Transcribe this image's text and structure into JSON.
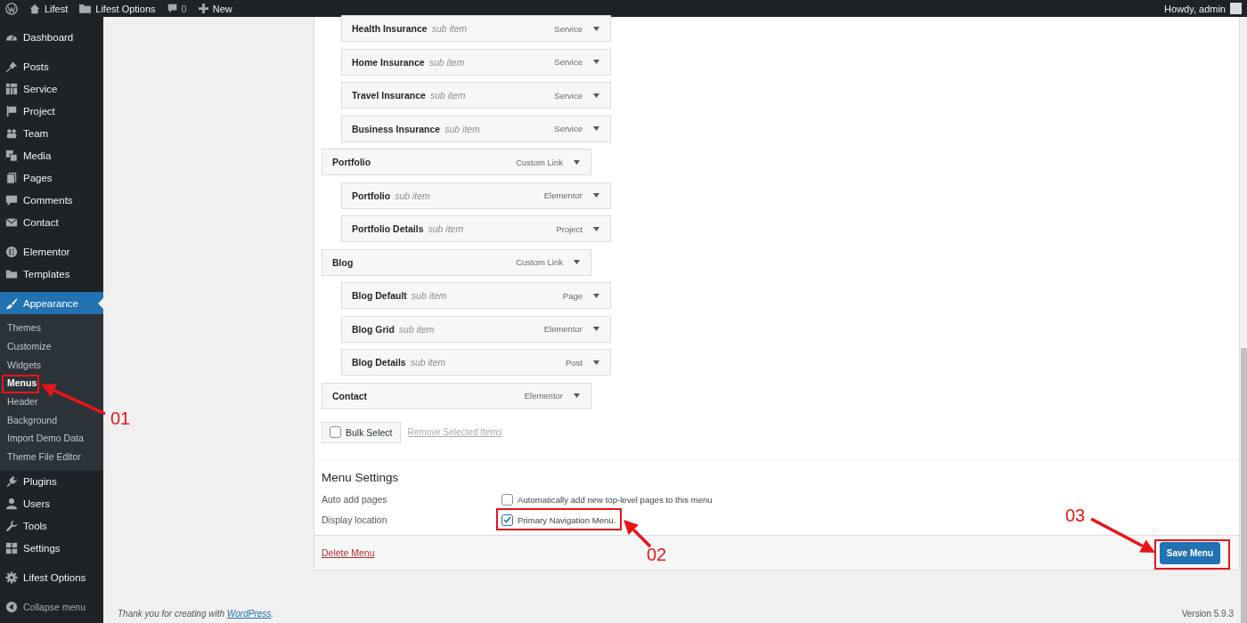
{
  "admin_bar": {
    "site": "Lifest",
    "options": "Lifest Options",
    "comments": "0",
    "new": "New",
    "greeting": "Howdy, admin"
  },
  "sidebar": {
    "groups": [
      {
        "items": [
          {
            "label": "Dashboard",
            "selected": false
          }
        ]
      },
      {
        "items": [
          {
            "label": "Posts",
            "selected": false
          },
          {
            "label": "Service",
            "selected": false
          },
          {
            "label": "Project",
            "selected": false
          },
          {
            "label": "Team",
            "selected": false
          },
          {
            "label": "Media",
            "selected": false
          },
          {
            "label": "Pages",
            "selected": false
          },
          {
            "label": "Comments",
            "selected": false
          },
          {
            "label": "Contact",
            "selected": false
          }
        ]
      },
      {
        "items": [
          {
            "label": "Elementor",
            "selected": false
          },
          {
            "label": "Templates",
            "selected": false
          }
        ]
      },
      {
        "items": [
          {
            "label": "Appearance",
            "selected": true,
            "children": [
              {
                "label": "Themes",
                "selected": false
              },
              {
                "label": "Customize",
                "selected": false
              },
              {
                "label": "Widgets",
                "selected": false
              },
              {
                "label": "Menus",
                "selected": true
              },
              {
                "label": "Header",
                "selected": false
              },
              {
                "label": "Background",
                "selected": false
              },
              {
                "label": "Import Demo Data",
                "selected": false
              },
              {
                "label": "Theme File Editor",
                "selected": false
              }
            ]
          },
          {
            "label": "Plugins",
            "selected": false
          },
          {
            "label": "Users",
            "selected": false
          },
          {
            "label": "Tools",
            "selected": false
          },
          {
            "label": "Settings",
            "selected": false
          }
        ]
      },
      {
        "items": [
          {
            "label": "Lifest Options",
            "selected": false
          }
        ]
      }
    ],
    "collapse_label": "Collapse menu"
  },
  "menu_editor": {
    "items": [
      {
        "children": [
          {
            "title": "Health Insurance",
            "note": "sub item",
            "type": "Service"
          },
          {
            "title": "Home Insurance",
            "note": "sub item",
            "type": "Service"
          },
          {
            "title": "Travel Insurance",
            "note": "sub item",
            "type": "Service"
          },
          {
            "title": "Business Insurance",
            "note": "sub item",
            "type": "Service"
          }
        ]
      },
      {
        "title": "Portfolio",
        "type": "Custom Link",
        "children": [
          {
            "title": "Portfolio",
            "note": "sub item",
            "type": "Elementor"
          },
          {
            "title": "Portfolio Details",
            "note": "sub item",
            "type": "Project"
          }
        ]
      },
      {
        "title": "Blog",
        "type": "Custom Link",
        "children": [
          {
            "title": "Blog Default",
            "note": "sub item",
            "type": "Page"
          },
          {
            "title": "Blog Grid",
            "note": "sub item",
            "type": "Elementor"
          },
          {
            "title": "Blog Details",
            "note": "sub item",
            "type": "Post"
          }
        ]
      },
      {
        "title": "Contact",
        "type": "Elementor"
      }
    ],
    "bulk_select": {
      "label": "Bulk Select",
      "checked": false
    },
    "remove_link": "Remove Selected Items",
    "settings": {
      "title": "Menu Settings",
      "rows": [
        {
          "label": "Auto add pages",
          "option": "Automatically add new top-level pages to this menu",
          "checked": false
        },
        {
          "label": "Display location",
          "option": "Primary Navigation Menu.",
          "checked": true
        }
      ]
    },
    "delete_link": "Delete Menu",
    "save_button": "Save Menu"
  },
  "footer": {
    "text": "Thank you for creating with ",
    "link": "WordPress",
    "after": ".",
    "version": "Version 5.9.3"
  },
  "annotations": [
    {
      "label": "01"
    },
    {
      "label": "02"
    },
    {
      "label": "03"
    }
  ]
}
